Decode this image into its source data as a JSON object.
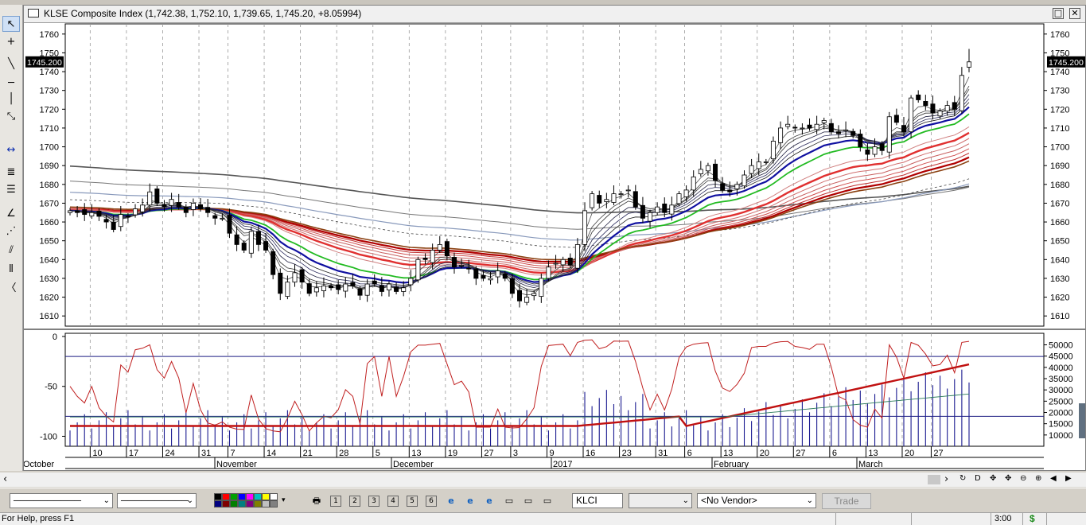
{
  "window": {
    "title": "KLSE Composite Index (1,742.38, 1,752.10, 1,739.65, 1,745.20, +8.05994)",
    "restore_glyph": "□",
    "close_glyph": "✕"
  },
  "left_toolbar": {
    "tools": [
      {
        "name": "pointer-tool",
        "glyph": "↖",
        "selected": true
      },
      {
        "name": "crosshair-tool",
        "glyph": "+"
      },
      {
        "name": "trendline-tool",
        "glyph": "╲"
      },
      {
        "name": "horizontal-line-tool",
        "glyph": "─"
      },
      {
        "name": "vertical-line-tool",
        "glyph": "│"
      },
      {
        "name": "fan-tool",
        "glyph": "⤡"
      },
      {
        "name": "zoom-tool",
        "glyph": "↔"
      },
      {
        "name": "fibonacci-retracement-tool",
        "glyph": "≣"
      },
      {
        "name": "fibonacci-extension-tool",
        "glyph": "☰"
      },
      {
        "name": "gann-angle-tool",
        "glyph": "∠"
      },
      {
        "name": "gann-fan-tool",
        "glyph": "⋰"
      },
      {
        "name": "channel-tool",
        "glyph": "⫽"
      },
      {
        "name": "cycle-lines-tool",
        "glyph": "⦀"
      },
      {
        "name": "arc-tool",
        "glyph": "〈"
      }
    ]
  },
  "chart_data": [
    {
      "type": "candlestick",
      "title": "KLSE Composite Index (1,742.38, 1,752.10, 1,739.65, 1,745.20, +8.05994)",
      "ylim": [
        1605,
        1765
      ],
      "y_ticks": [
        1610,
        1620,
        1630,
        1640,
        1650,
        1660,
        1670,
        1680,
        1690,
        1700,
        1710,
        1720,
        1730,
        1740,
        1750,
        1760
      ],
      "last_price_label": "1745.200",
      "last_bar": {
        "open": 1742.38,
        "high": 1752.1,
        "low": 1739.65,
        "close": 1745.2,
        "change": 8.05994
      },
      "overlays": "guppy multiple moving averages (short-term blue group, long-term red group, gray long averages)",
      "closes": [
        1666,
        1665,
        1664,
        1665,
        1663,
        1660,
        1656,
        1664,
        1663,
        1667,
        1669,
        1676,
        1670,
        1668,
        1672,
        1668,
        1665,
        1670,
        1667,
        1665,
        1662,
        1662,
        1654,
        1648,
        1645,
        1655,
        1648,
        1645,
        1632,
        1622,
        1628,
        1633,
        1628,
        1622,
        1625,
        1626,
        1625,
        1624,
        1627,
        1626,
        1621,
        1627,
        1627,
        1623,
        1627,
        1623,
        1625,
        1630,
        1640,
        1640,
        1645,
        1648,
        1642,
        1636,
        1637,
        1635,
        1630,
        1630,
        1630,
        1634,
        1630,
        1622,
        1618,
        1620,
        1622,
        1630,
        1636,
        1638,
        1640,
        1637,
        1648,
        1666,
        1675,
        1670,
        1672,
        1675,
        1675,
        1677,
        1668,
        1662,
        1665,
        1668,
        1665,
        1669,
        1675,
        1677,
        1684,
        1688,
        1690,
        1682,
        1677,
        1676,
        1680,
        1685,
        1690,
        1692,
        1692,
        1703,
        1710,
        1712,
        1710,
        1710,
        1710,
        1712,
        1714,
        1708,
        1707,
        1709,
        1706,
        1700,
        1696,
        1700,
        1698,
        1716,
        1713,
        1708,
        1726,
        1725,
        1722,
        1718,
        1719,
        1722,
        1720,
        1738,
        1745.2
      ],
      "panel2": {
        "y_ticks_left": [
          0,
          -50,
          -100
        ],
        "y_ticks_right": [
          10000,
          15000,
          20000,
          25000,
          30000,
          35000,
          40000,
          45000,
          50000
        ],
        "reference_lines": [
          -20,
          -80
        ],
        "oscillator": "%R-like oscillator (red line) with volume histogram and averages"
      },
      "x_day_labels": [
        "10",
        "17",
        "24",
        "31",
        "7",
        "14",
        "21",
        "28",
        "5",
        "13",
        "19",
        "27",
        "3",
        "9",
        "16",
        "23",
        "31",
        "6",
        "13",
        "20",
        "27",
        "6",
        "13",
        "20",
        "27"
      ],
      "x_month_labels": [
        "October",
        "November",
        "December",
        "2017",
        "February",
        "March"
      ]
    }
  ],
  "scrollbar": {
    "left_arrow": "‹",
    "right_arrow": "›"
  },
  "nav_buttons": [
    "↻",
    "D",
    "✥",
    "✥",
    "⊖",
    "⊕",
    "◀",
    "▶"
  ],
  "bottom_toolbar": {
    "line_style_combo": "──────────",
    "line_width_combo": "──────────",
    "palette": [
      "#000000",
      "#ff0000",
      "#00a000",
      "#0000ff",
      "#ff00ff",
      "#00c0c0",
      "#ffff00",
      "#ffffff",
      "#000080",
      "#800000",
      "#008000",
      "#008080",
      "#800080",
      "#808000",
      "#c0c0c0",
      "#808080"
    ],
    "icon_buttons": [
      "🖶",
      "1",
      "2",
      "3",
      "4",
      "5",
      "6",
      "e",
      "e",
      "e",
      "▭",
      "▭",
      "▭"
    ],
    "symbol_value": "KLCI",
    "interval_combo": "",
    "vendor_combo": "<No Vendor>",
    "trade_button": "Trade"
  },
  "status": {
    "help_text": "For Help, press F1",
    "time": "3:00",
    "dollar": "$"
  }
}
